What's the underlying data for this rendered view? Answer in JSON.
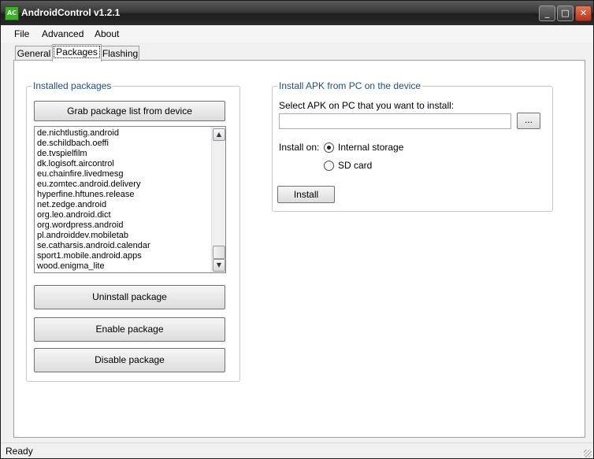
{
  "window": {
    "title": "AndroidControl v1.2.1",
    "icon_text": "AC",
    "minimize_glyph": "_",
    "maximize_glyph": "□",
    "close_glyph": "✕"
  },
  "menu": {
    "items": [
      "File",
      "Advanced",
      "About"
    ]
  },
  "tabs": [
    {
      "label": "General",
      "active": false
    },
    {
      "label": "Packages",
      "active": true
    },
    {
      "label": "Flashing",
      "active": false
    }
  ],
  "installed": {
    "title": "Installed packages",
    "grab_button": "Grab package list from device",
    "packages": [
      "de.nichtlustig.android",
      "de.schildbach.oeffi",
      "de.tvspielfilm",
      "dk.logisoft.aircontrol",
      "eu.chainfire.livedmesg",
      "eu.zomtec.android.delivery",
      "hyperfine.hftunes.release",
      "net.zedge.android",
      "org.leo.android.dict",
      "org.wordpress.android",
      "pl.androiddev.mobiletab",
      "se.catharsis.android.calendar",
      "sport1.mobile.android.apps",
      "wood.enigma_lite"
    ],
    "uninstall_button": "Uninstall package",
    "enable_button": "Enable package",
    "disable_button": "Disable package"
  },
  "install_apk": {
    "title": "Install APK from PC on the device",
    "select_label": "Select APK on PC that you want to install:",
    "path_value": "",
    "browse_button": "...",
    "install_on_label": "Install on:",
    "options": [
      {
        "label": "Internal storage",
        "selected": true
      },
      {
        "label": "SD card",
        "selected": false
      }
    ],
    "install_button": "Install"
  },
  "status": {
    "text": "Ready"
  }
}
